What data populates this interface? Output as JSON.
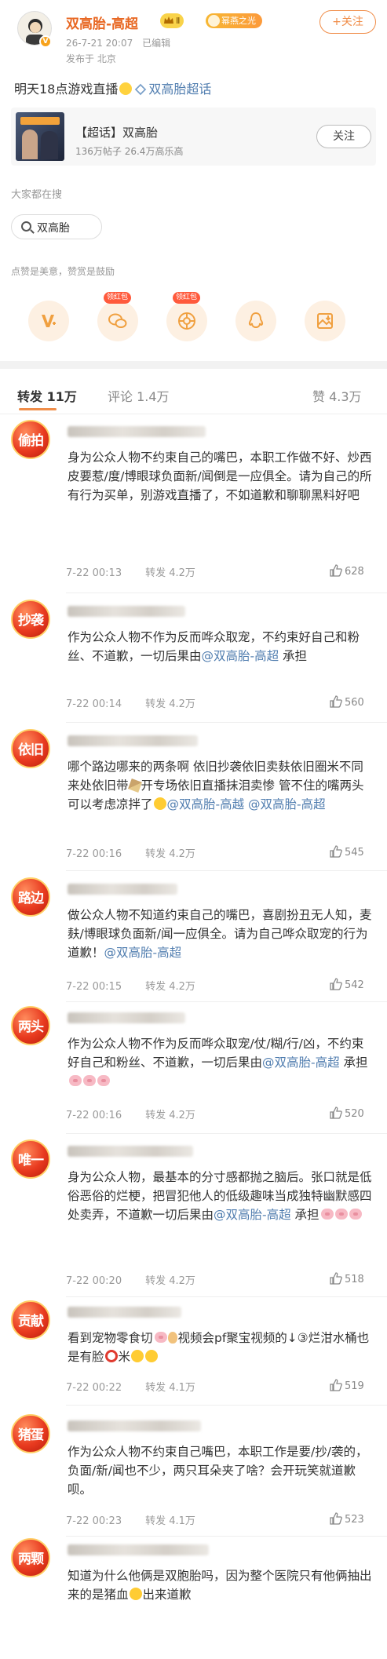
{
  "post": {
    "author": "双高胎-高超",
    "level_badge": "Ⅱ",
    "fans_badge": "幂燕之光",
    "follow_label": "+关注",
    "date": "26-7-21 20:07",
    "edited": "已编辑",
    "location": "发布于 北京",
    "text_before": "明天18点游戏直播",
    "topic": "双高胎超话"
  },
  "topic_card": {
    "title": "【超话】双高胎",
    "stats": "136万帖子 26.4万高乐高",
    "follow_label": "关注"
  },
  "search": {
    "hint": "大家都在搜",
    "chip": "双高胎"
  },
  "like_hint": "点赞是美意，赞赏是鼓励",
  "share": {
    "hongbao": "领红包",
    "icons": [
      "weibo-share-icon",
      "wechat-icon",
      "moments-icon",
      "qq-icon",
      "save-image-icon"
    ]
  },
  "tabs": {
    "repost": "转发 11万",
    "comment": "评论 1.4万",
    "like": "赞 4.3万"
  },
  "reposts": [
    {
      "avatar": "偷拍",
      "text": "身为公众人物不约束自己的嘴巴，本职工作做不好、炒西皮要惹/度/博眼球负面新/闻倒是一应俱全。请为自己的所有行为买单，别游戏直播了，不如道歉和聊聊黑料好吧",
      "time": "7-22 00:13",
      "reposts": "转发 4.2万",
      "likes": "628"
    },
    {
      "avatar": "抄袭",
      "text": "作为公众人物不作为反而哗众取宠，不约束好自己和粉丝、不道歉，一切后果由",
      "at": "@双高胎-高超",
      "tail": " 承担",
      "time": "7-22 00:14",
      "reposts": "转发 4.2万",
      "likes": "560"
    },
    {
      "avatar": "依旧",
      "text": "哪个路边哪来的两条啊 依旧抄袭依旧卖麸依旧圈米不同来处依旧带",
      "text2": "开专场依旧直播抹泪卖惨 管不住的嘴两头可以考虑凉拌了",
      "at": "@双高胎-高越 @双高胎-高超",
      "time": "7-22 00:16",
      "reposts": "转发 4.2万",
      "likes": "545"
    },
    {
      "avatar": "路边",
      "text": "做公众人物不知道约束自己的嘴巴，喜剧扮丑无人知，麦麸/博眼球负面新/闻一应俱全。请为自己哗众取宠的行为道歉！",
      "at": "@双高胎-高超",
      "time": "7-22 00:15",
      "reposts": "转发 4.2万",
      "likes": "542"
    },
    {
      "avatar": "两头",
      "text": "作为公众人物不作为反而哗众取宠/仗/糊/行/凶，不约束好自己和粉丝、不道歉，一切后果由",
      "at": "@双高胎-高超",
      "tail": " 承担",
      "time": "7-22 00:16",
      "reposts": "转发 4.2万",
      "likes": "520"
    },
    {
      "avatar": "唯一",
      "text": "身为公众人物，最基本的分寸感都抛之脑后。张口就是低俗恶俗的烂梗，把冒犯他人的低级趣味当成独特幽默感四处卖弄，不道歉一切后果由",
      "at": "@双高胎-高超",
      "tail": " 承担",
      "time": "7-22 00:20",
      "reposts": "转发 4.2万",
      "likes": "518"
    },
    {
      "avatar": "贡献",
      "text": "看到宠物零食切",
      "text2": "视频会pf聚宝视频的↓③烂泔水桶也是有脸",
      "text3": "米",
      "time": "7-22 00:22",
      "reposts": "转发 4.1万",
      "likes": "519"
    },
    {
      "avatar": "猪蛋",
      "text": "作为公众人物不约束自己嘴巴，本职工作是要/抄/袭的，负面/新/闻也不少，两只耳朵夹了啥？会开玩笑就道歉呗。",
      "time": "7-22 00:23",
      "reposts": "转发 4.1万",
      "likes": "523"
    },
    {
      "avatar": "两颗",
      "text": "知道为什么他俩是双胞胎吗，因为整个医院只有他俩抽出来的是猪血",
      "text2": "出来道歉"
    }
  ]
}
